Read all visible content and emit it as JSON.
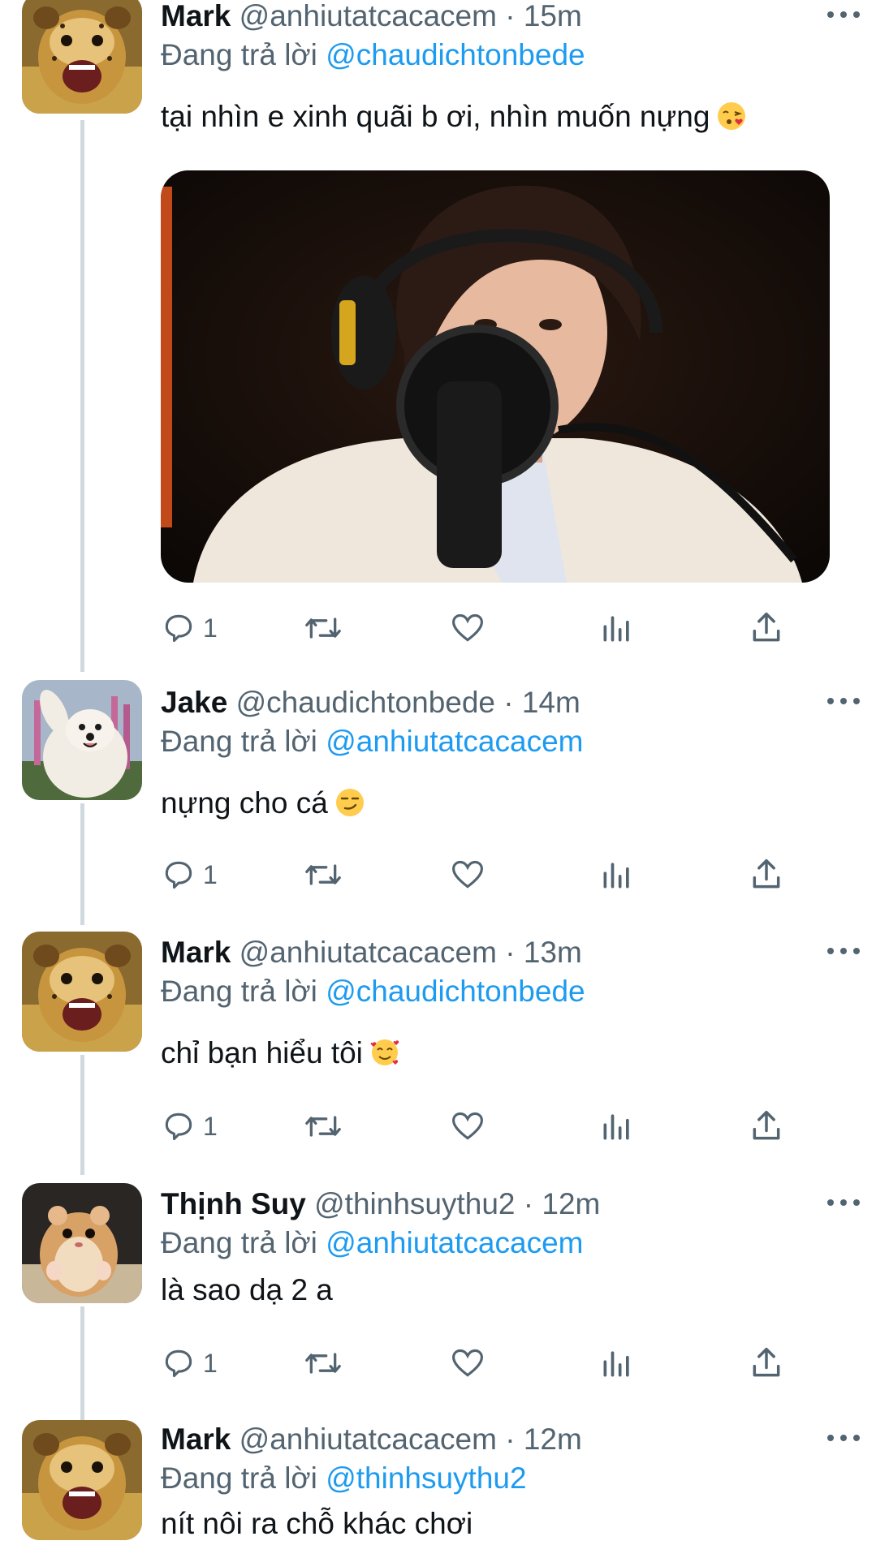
{
  "tweets": [
    {
      "name": "Mark",
      "handle": "@anhiutatcacacem",
      "time": "· 15m",
      "reply_prefix": "Đang trả lời",
      "reply_to": "@chaudichtonbede",
      "text": "tại nhìn e xinh quãi b ơi, nhìn muốn nựng",
      "emoji": "face-blowing-kiss",
      "reply_count": "1",
      "has_media": true
    },
    {
      "name": "Jake",
      "handle": "@chaudichtonbede",
      "time": "· 14m",
      "reply_prefix": "Đang trả lời",
      "reply_to": "@anhiutatcacacem",
      "text": "nựng cho cá",
      "emoji": "smirking-face",
      "reply_count": "1"
    },
    {
      "name": "Mark",
      "handle": "@anhiutatcacacem",
      "time": "· 13m",
      "reply_prefix": "Đang trả lời",
      "reply_to": "@chaudichtonbede",
      "text": "chỉ bạn hiểu tôi",
      "emoji": "smiling-face-with-hearts",
      "reply_count": "1"
    },
    {
      "name": "Thịnh Suy",
      "handle": "@thinhsuythu2",
      "time": "· 12m",
      "reply_prefix": "Đang trả lời",
      "reply_to": "@anhiutatcacacem",
      "text": "là sao dạ 2 a",
      "reply_count": "1"
    },
    {
      "name": "Mark",
      "handle": "@anhiutatcacacem",
      "time": "· 12m",
      "reply_prefix": "Đang trả lời",
      "reply_to": "@thinhsuythu2",
      "text": "nít nôi ra chỗ khác chơi"
    }
  ],
  "colors": {
    "text": "#0f1419",
    "secondary": "#536471",
    "accent": "#1d9bf0",
    "thread_line": "#cfd9de"
  }
}
